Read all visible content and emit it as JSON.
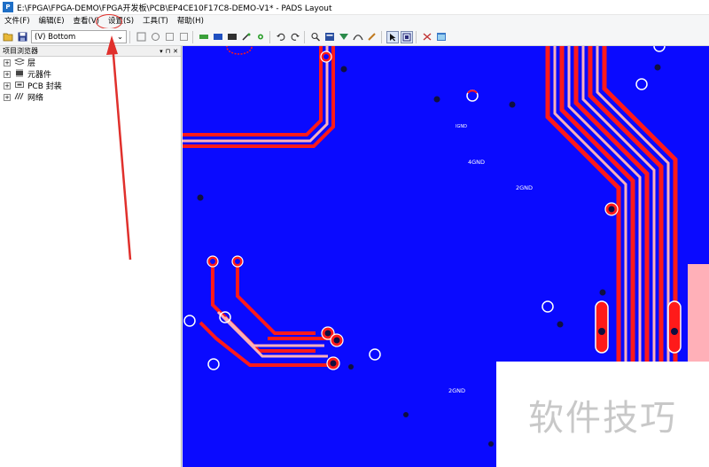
{
  "window": {
    "title": "E:\\FPGA\\FPGA-DEMO\\FPGA开发板\\PCB\\EP4CE10F17C8-DEMO-V1* - PADS Layout"
  },
  "menu": {
    "items": [
      {
        "label": "文件(F)"
      },
      {
        "label": "编辑(E)"
      },
      {
        "label": "查看(V)"
      },
      {
        "label": "设置(S)"
      },
      {
        "label": "工具(T)"
      },
      {
        "label": "帮助(H)"
      }
    ]
  },
  "toolbar": {
    "layer_select": {
      "value": "(V) Bottom"
    }
  },
  "sidebar": {
    "title": "项目浏览器",
    "controls": [
      "▾",
      "⊓",
      "✕"
    ],
    "items": [
      {
        "label": "层",
        "icon": "layers-icon"
      },
      {
        "label": "元器件",
        "icon": "component-icon"
      },
      {
        "label": "PCB 封装",
        "icon": "footprint-icon"
      },
      {
        "label": "网络",
        "icon": "net-icon"
      }
    ]
  },
  "canvas": {
    "labels": [
      {
        "text": "4GND"
      },
      {
        "text": "2GND"
      },
      {
        "text": "2GND"
      },
      {
        "text": "IGND"
      }
    ]
  },
  "colors": {
    "board": "#0a0aff",
    "trace": "#ff1a1a",
    "trace_light": "#ffb0b8",
    "annotation": "#e0302c"
  },
  "watermark": {
    "text": "软件技巧"
  }
}
